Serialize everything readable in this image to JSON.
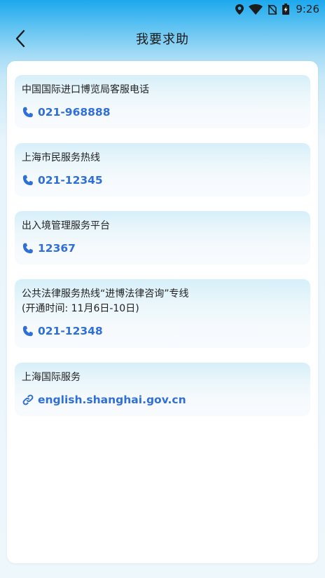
{
  "status_bar": {
    "time": "9:26",
    "icons": [
      "location-icon",
      "wifi-icon",
      "no-sim-icon",
      "battery-charging-icon"
    ]
  },
  "header": {
    "title": "我要求助",
    "back_icon": "chevron-left-icon"
  },
  "cards": [
    {
      "title": "中国国际进口博览局客服电话",
      "value": "021-968888",
      "icon": "phone-icon"
    },
    {
      "title": "上海市民服务热线",
      "value": "021-12345",
      "icon": "phone-icon"
    },
    {
      "title": "出入境管理服务平台",
      "value": "12367",
      "icon": "phone-icon"
    },
    {
      "title": "公共法律服务热线“进博法律咨询”专线\n(开通时间: 11月6日-10日)",
      "value": "021-12348",
      "icon": "phone-icon"
    },
    {
      "title": "上海国际服务",
      "value": "english.shanghai.gov.cn",
      "icon": "link-icon"
    }
  ],
  "colors": {
    "accent": "#2f6fd8",
    "header_top": "#1ca8ee",
    "text": "#222222"
  }
}
